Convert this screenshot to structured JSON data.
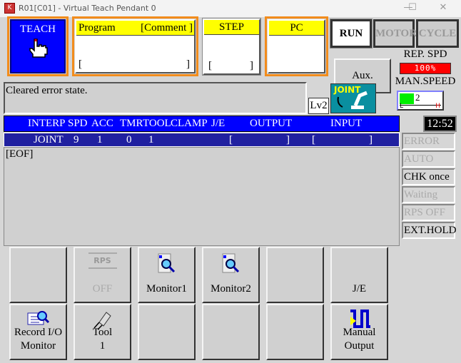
{
  "window": {
    "title": "R01[C01] - Virtual Teach Pendant 0",
    "minimize": "—",
    "maximize": "☐",
    "close": "✕"
  },
  "mode": {
    "label": "TEACH",
    "icon": "hand-pointer-icon"
  },
  "program": {
    "label": "Program",
    "comment": "[Comment ]",
    "value_open": "[",
    "value_close": "]"
  },
  "step": {
    "label": "STEP",
    "value_open": "[",
    "value_close": "]"
  },
  "pc": {
    "label": "PC"
  },
  "top_buttons": {
    "run": "RUN",
    "motor": "MOTOR",
    "cycle": "CYCLE",
    "aux": "Aux."
  },
  "rep_speed": {
    "label": "REP. SPD",
    "value": "100%",
    "color": "#ff0000"
  },
  "man_speed": {
    "label": "MAN.SPEED",
    "level": 2,
    "level_label": "2",
    "low": "L",
    "high": "H",
    "color": "#00ee00"
  },
  "message": "Cleared error state.",
  "level": "Lv2",
  "interp_mode": {
    "label": "JOINT",
    "icon": "robot-arm-icon"
  },
  "header": {
    "columns": [
      "INTERP",
      "SPD",
      "ACC",
      "TMR",
      "TOOL",
      "CLAMP",
      "J/E",
      "OUTPUT",
      "INPUT"
    ],
    "time": "12:52"
  },
  "step_row": {
    "interp": "JOINT",
    "spd": "9",
    "acc": "1",
    "tmr": "0",
    "tool": "1",
    "output": "[                    ]",
    "input": "[                    ]"
  },
  "program_lines": [
    "[EOF]"
  ],
  "status": [
    {
      "label": "ERROR",
      "active": false
    },
    {
      "label": "AUTO",
      "active": false
    },
    {
      "label": "CHK once",
      "active": true
    },
    {
      "label": "Waiting",
      "active": false
    },
    {
      "label": "RPS OFF",
      "active": false
    },
    {
      "label": "EXT.HOLD",
      "active": true
    }
  ],
  "function_keys": {
    "row1": [
      {
        "label": ""
      },
      {
        "label": "OFF",
        "icon_text": "RPS",
        "icon": "rps-icon",
        "disabled": true
      },
      {
        "label": "Monitor1",
        "icon": "monitor-search-icon"
      },
      {
        "label": "Monitor2",
        "icon": "monitor-search-icon"
      },
      {
        "label": ""
      },
      {
        "label": "J/E"
      }
    ],
    "row2": [
      {
        "label": "Record I/O",
        "label2": "Monitor",
        "icon": "record-io-monitor-icon"
      },
      {
        "label": "Tool",
        "label2": "1",
        "icon": "tool-icon"
      },
      {
        "label": ""
      },
      {
        "label": ""
      },
      {
        "label": ""
      },
      {
        "label": "Manual",
        "label2": "Output",
        "icon": "pulse-signal-icon"
      }
    ]
  }
}
